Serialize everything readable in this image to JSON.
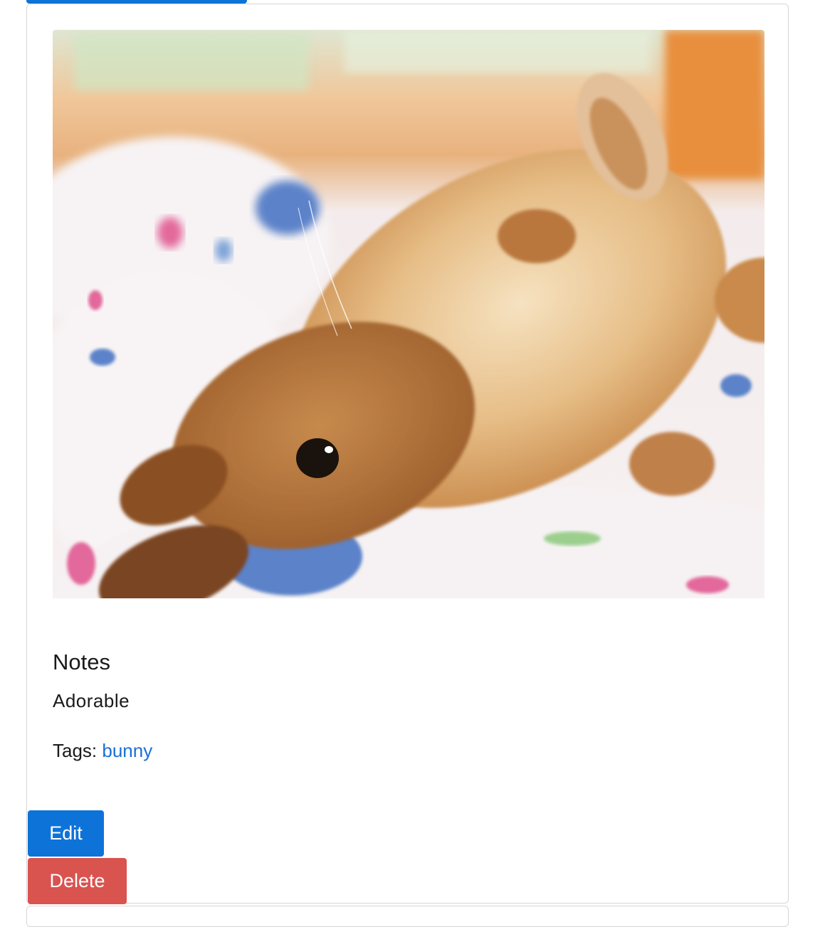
{
  "photo": {
    "subject": "bunny",
    "colors": {
      "bedding": "#f3eeee",
      "fur": "#c98a4b",
      "fur_light": "#efd3a8",
      "spot_blue": "#5b82c9",
      "spot_pink": "#e3679b",
      "window_orange": "#e88f3c"
    }
  },
  "notes": {
    "heading": "Notes",
    "text": "Adorable"
  },
  "tags": {
    "label": "Tags: ",
    "items": [
      "bunny"
    ]
  },
  "actions": {
    "edit_label": "Edit",
    "delete_label": "Delete"
  },
  "colors": {
    "primary": "#0d73d9",
    "danger": "#d9534f",
    "link": "#1a6fd6",
    "border": "#d6d6d6"
  }
}
